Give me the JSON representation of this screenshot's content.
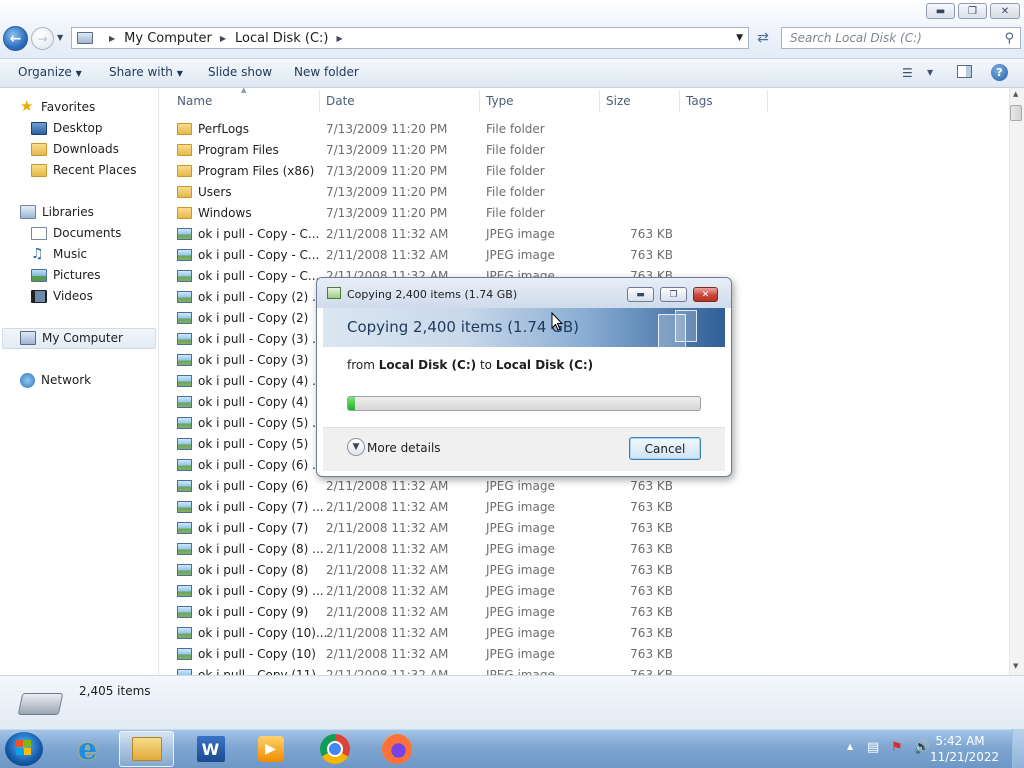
{
  "window": {
    "caption_buttons": {
      "minimize": "▬",
      "maximize": "❐",
      "close": "✕"
    },
    "address": {
      "crumbs": [
        "My Computer",
        "Local Disk (C:)"
      ]
    },
    "search": {
      "placeholder": "Search Local Disk (C:)"
    }
  },
  "toolbar": {
    "organize": "Organize",
    "share_with": "Share with",
    "slide_show": "Slide show",
    "new_folder": "New folder"
  },
  "sidebar": {
    "favorites": {
      "label": "Favorites",
      "items": [
        {
          "label": "Desktop",
          "icon": "desktop-icon"
        },
        {
          "label": "Downloads",
          "icon": "downloads-icon"
        },
        {
          "label": "Recent Places",
          "icon": "recent-places-icon"
        }
      ]
    },
    "libraries": {
      "label": "Libraries",
      "items": [
        {
          "label": "Documents",
          "icon": "documents-icon"
        },
        {
          "label": "Music",
          "icon": "music-icon"
        },
        {
          "label": "Pictures",
          "icon": "pictures-icon"
        },
        {
          "label": "Videos",
          "icon": "videos-icon"
        }
      ]
    },
    "computer": "My Computer",
    "network": "Network"
  },
  "columns": {
    "name": "Name",
    "date": "Date",
    "type": "Type",
    "size": "Size",
    "tags": "Tags"
  },
  "files": [
    {
      "name": "PerfLogs",
      "date": "7/13/2009 11:20 PM",
      "type": "File folder",
      "size": "",
      "kind": "folder"
    },
    {
      "name": "Program Files",
      "date": "7/13/2009 11:20 PM",
      "type": "File folder",
      "size": "",
      "kind": "folder"
    },
    {
      "name": "Program Files (x86)",
      "date": "7/13/2009 11:20 PM",
      "type": "File folder",
      "size": "",
      "kind": "folder"
    },
    {
      "name": "Users",
      "date": "7/13/2009 11:20 PM",
      "type": "File folder",
      "size": "",
      "kind": "folder"
    },
    {
      "name": "Windows",
      "date": "7/13/2009 11:20 PM",
      "type": "File folder",
      "size": "",
      "kind": "folder"
    },
    {
      "name": "ok i pull - Copy - C...",
      "date": "2/11/2008 11:32 AM",
      "type": "JPEG image",
      "size": "763 KB",
      "kind": "jpeg"
    },
    {
      "name": "ok i pull - Copy - C...",
      "date": "2/11/2008 11:32 AM",
      "type": "JPEG image",
      "size": "763 KB",
      "kind": "jpeg"
    },
    {
      "name": "ok i pull - Copy - C...",
      "date": "2/11/2008 11:32 AM",
      "type": "JPEG image",
      "size": "763 KB",
      "kind": "jpeg"
    },
    {
      "name": "ok i pull - Copy (2) ...",
      "date": "2/11/2008 11:32 AM",
      "type": "JPEG image",
      "size": "763 KB",
      "kind": "jpeg"
    },
    {
      "name": "ok i pull - Copy (2)",
      "date": "2/11/2008 11:32 AM",
      "type": "JPEG image",
      "size": "763 KB",
      "kind": "jpeg"
    },
    {
      "name": "ok i pull - Copy (3) ...",
      "date": "2/11/2008 11:32 AM",
      "type": "JPEG image",
      "size": "763 KB",
      "kind": "jpeg"
    },
    {
      "name": "ok i pull - Copy (3)",
      "date": "2/11/2008 11:32 AM",
      "type": "JPEG image",
      "size": "763 KB",
      "kind": "jpeg"
    },
    {
      "name": "ok i pull - Copy (4) ...",
      "date": "2/11/2008 11:32 AM",
      "type": "JPEG image",
      "size": "763 KB",
      "kind": "jpeg"
    },
    {
      "name": "ok i pull - Copy (4)",
      "date": "2/11/2008 11:32 AM",
      "type": "JPEG image",
      "size": "763 KB",
      "kind": "jpeg"
    },
    {
      "name": "ok i pull - Copy (5) ...",
      "date": "2/11/2008 11:32 AM",
      "type": "JPEG image",
      "size": "763 KB",
      "kind": "jpeg"
    },
    {
      "name": "ok i pull - Copy (5)",
      "date": "2/11/2008 11:32 AM",
      "type": "JPEG image",
      "size": "763 KB",
      "kind": "jpeg"
    },
    {
      "name": "ok i pull - Copy (6) ...",
      "date": "2/11/2008 11:32 AM",
      "type": "JPEG image",
      "size": "763 KB",
      "kind": "jpeg"
    },
    {
      "name": "ok i pull - Copy (6)",
      "date": "2/11/2008 11:32 AM",
      "type": "JPEG image",
      "size": "763 KB",
      "kind": "jpeg"
    },
    {
      "name": "ok i pull - Copy (7) ...",
      "date": "2/11/2008 11:32 AM",
      "type": "JPEG image",
      "size": "763 KB",
      "kind": "jpeg"
    },
    {
      "name": "ok i pull - Copy (7)",
      "date": "2/11/2008 11:32 AM",
      "type": "JPEG image",
      "size": "763 KB",
      "kind": "jpeg"
    },
    {
      "name": "ok i pull - Copy (8) ...",
      "date": "2/11/2008 11:32 AM",
      "type": "JPEG image",
      "size": "763 KB",
      "kind": "jpeg"
    },
    {
      "name": "ok i pull - Copy (8)",
      "date": "2/11/2008 11:32 AM",
      "type": "JPEG image",
      "size": "763 KB",
      "kind": "jpeg"
    },
    {
      "name": "ok i pull - Copy (9) ...",
      "date": "2/11/2008 11:32 AM",
      "type": "JPEG image",
      "size": "763 KB",
      "kind": "jpeg"
    },
    {
      "name": "ok i pull - Copy (9)",
      "date": "2/11/2008 11:32 AM",
      "type": "JPEG image",
      "size": "763 KB",
      "kind": "jpeg"
    },
    {
      "name": "ok i pull - Copy (10)...",
      "date": "2/11/2008 11:32 AM",
      "type": "JPEG image",
      "size": "763 KB",
      "kind": "jpeg"
    },
    {
      "name": "ok i pull - Copy (10)",
      "date": "2/11/2008 11:32 AM",
      "type": "JPEG image",
      "size": "763 KB",
      "kind": "jpeg"
    },
    {
      "name": "ok i pull - Copy (11)",
      "date": "2/11/2008 11:32 AM",
      "type": "JPEG image",
      "size": "763 KB",
      "kind": "jpeg"
    }
  ],
  "details": {
    "item_count": "2,405 items",
    "icon": "drive-icon"
  },
  "dialog": {
    "title": "Copying 2,400 items (1.74 GB)",
    "heading": "Copying 2,400 items (1.74 GB)",
    "from_text": "from",
    "source": "Local Disk (C:)",
    "to_text": "to",
    "destination": "Local Disk (C:)",
    "progress": 0.02,
    "more_details": "More details",
    "cancel": "Cancel",
    "caption_buttons": {
      "minimize": "▬",
      "maximize": "❐",
      "close": "✕"
    }
  },
  "taskbar": {
    "apps": [
      "start-orb",
      "internet-explorer",
      "windows-explorer",
      "word",
      "media-player",
      "chrome",
      "firefox"
    ],
    "clock": {
      "time": "5:42 AM",
      "date": "11/21/2022"
    }
  },
  "colors": {
    "accent": "#2e6fbf",
    "progress": "#1fb21f",
    "close": "#c9463a",
    "taskbar": "#7fa6d1"
  }
}
